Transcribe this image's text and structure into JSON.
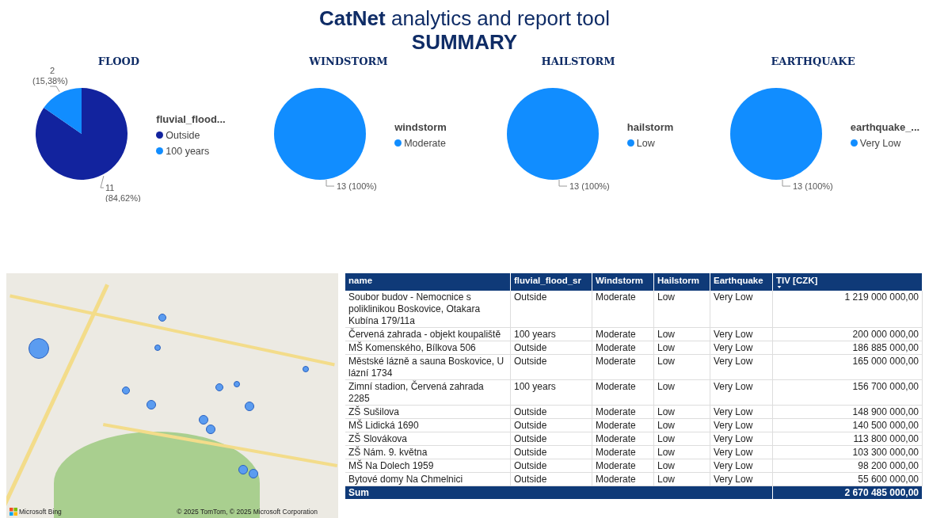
{
  "header": {
    "title": "**CatNet** analytics and report tool",
    "subtitle": "SUMMARY"
  },
  "charts": [
    {
      "title": "FLOOD",
      "legend": {
        "title": "fluvial_flood...",
        "items": [
          {
            "color": "#12239e"
          },
          {
            "color": "#118dff"
          }
        ]
      },
      "slice_labels": [
        {
          "value": "11",
          "percent": "(84,62%)"
        },
        {
          "value": "2",
          "percent": "(15,38%)"
        }
      ],
      "chart_data": {
        "type": "pie",
        "categories": [
          "Outside",
          "100 years"
        ],
        "values": [
          84.62,
          15.38
        ]
      }
    },
    {
      "title": "WINDSTORM",
      "legend": {
        "title": "windstorm",
        "items": [
          {
            "color": "#118dff"
          }
        ]
      },
      "slice_labels": [
        {
          "value": "13",
          "percent": "(100%)"
        }
      ],
      "chart_data": {
        "type": "pie",
        "categories": [
          "Moderate"
        ],
        "values": [
          100
        ]
      }
    },
    {
      "title": "HAILSTORM",
      "legend": {
        "title": "hailstorm",
        "items": [
          {
            "color": "#118dff"
          }
        ]
      },
      "slice_labels": [
        {
          "value": "13",
          "percent": "(100%)"
        }
      ],
      "chart_data": {
        "type": "pie",
        "categories": [
          "Low"
        ],
        "values": [
          100
        ]
      }
    },
    {
      "title": "EARTHQUAKE",
      "legend": {
        "title": "earthquake_...",
        "items": [
          {
            "color": "#118dff"
          }
        ]
      },
      "slice_labels": [
        {
          "value": "13",
          "percent": "(100%)"
        }
      ],
      "chart_data": {
        "type": "pie",
        "categories": [
          "Very Low"
        ],
        "values": [
          100
        ]
      }
    }
  ],
  "map": {
    "logo": "Microsoft Bing",
    "copyright": "© 2025 TomTom, © 2025 Microsoft Corporation"
  },
  "table": {
    "columns": [
      {
        "label": "name",
        "sorted": false
      },
      {
        "label": "fluvial_flood_sr",
        "sorted": false
      },
      {
        "label": "Windstorm",
        "sorted": false
      },
      {
        "label": "Hailstorm",
        "sorted": false
      },
      {
        "label": "Earthquake",
        "sorted": false
      },
      {
        "label": "TIV [CZK]",
        "sorted": true
      }
    ],
    "rows": [
      [
        "Soubor budov - Nemocnice s poliklinikou Boskovice, Otakara Kubína 179/11a",
        "Outside",
        "Moderate",
        "Low",
        "Very Low",
        "1 219 000 000,00"
      ],
      [
        "Červená zahrada - objekt koupaliště",
        "100 years",
        "Moderate",
        "Low",
        "Very Low",
        "200 000 000,00"
      ],
      [
        "MŠ Komenského, Bílkova 506",
        "Outside",
        "Moderate",
        "Low",
        "Very Low",
        "186 885 000,00"
      ],
      [
        "Městské lázně a sauna Boskovice, U lázní 1734",
        "Outside",
        "Moderate",
        "Low",
        "Very Low",
        "165 000 000,00"
      ],
      [
        "Zimní stadion, Červená zahrada 2285",
        "100 years",
        "Moderate",
        "Low",
        "Very Low",
        "156 700 000,00"
      ],
      [
        "ZŠ Sušilova",
        "Outside",
        "Moderate",
        "Low",
        "Very Low",
        "148 900 000,00"
      ],
      [
        "MŠ Lidická 1690",
        "Outside",
        "Moderate",
        "Low",
        "Very Low",
        "140 500 000,00"
      ],
      [
        "ZŠ Slovákova",
        "Outside",
        "Moderate",
        "Low",
        "Very Low",
        "113 800 000,00"
      ],
      [
        "ZŠ Nám. 9. května",
        "Outside",
        "Moderate",
        "Low",
        "Very Low",
        "103 300 000,00"
      ],
      [
        "MŠ Na Dolech 1959",
        "Outside",
        "Moderate",
        "Low",
        "Very Low",
        "98 200 000,00"
      ],
      [
        "Bytové domy Na Chmelnici",
        "Outside",
        "Moderate",
        "Low",
        "Very Low",
        "55 600 000,00"
      ]
    ],
    "total": {
      "label": "Sum",
      "value": "2 670 485 000,00"
    }
  }
}
